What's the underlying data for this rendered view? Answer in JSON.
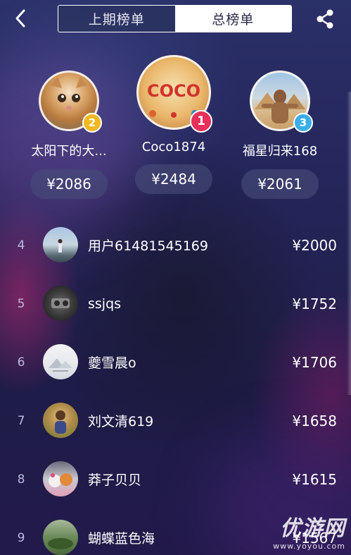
{
  "header": {
    "tabs": [
      {
        "label": "上期榜单",
        "active": false
      },
      {
        "label": "总榜单",
        "active": true
      }
    ]
  },
  "podium": [
    {
      "rank": "2",
      "name": "太阳下的大...",
      "amount": "¥2086",
      "badge_color": "#f2b820",
      "avatar": "cat-photo"
    },
    {
      "rank": "1",
      "name": "Coco1874",
      "amount": "¥2484",
      "badge_color": "#e8305a",
      "avatar": "coco-poster"
    },
    {
      "rank": "3",
      "name": "福星归来168",
      "amount": "¥2061",
      "badge_color": "#3aaee8",
      "avatar": "pyramid-photo"
    }
  ],
  "list": [
    {
      "rank": "4",
      "name": "用户61481545169",
      "amount": "¥2000"
    },
    {
      "rank": "5",
      "name": "ssjqs",
      "amount": "¥1752"
    },
    {
      "rank": "6",
      "name": "夔雪晨o",
      "amount": "¥1706"
    },
    {
      "rank": "7",
      "name": "刘文清619",
      "amount": "¥1658"
    },
    {
      "rank": "8",
      "name": "莽子贝贝",
      "amount": "¥1615"
    },
    {
      "rank": "9",
      "name": "蝴蝶蓝色海",
      "amount": "¥1567"
    }
  ],
  "coco_poster_text": "COCO",
  "watermark": {
    "title": "优游网",
    "url": "www.yoyou.com"
  },
  "colors": {
    "background": "#1e1c48",
    "gold": "#f2b820",
    "red": "#e8305a",
    "blue": "#3aaee8"
  }
}
